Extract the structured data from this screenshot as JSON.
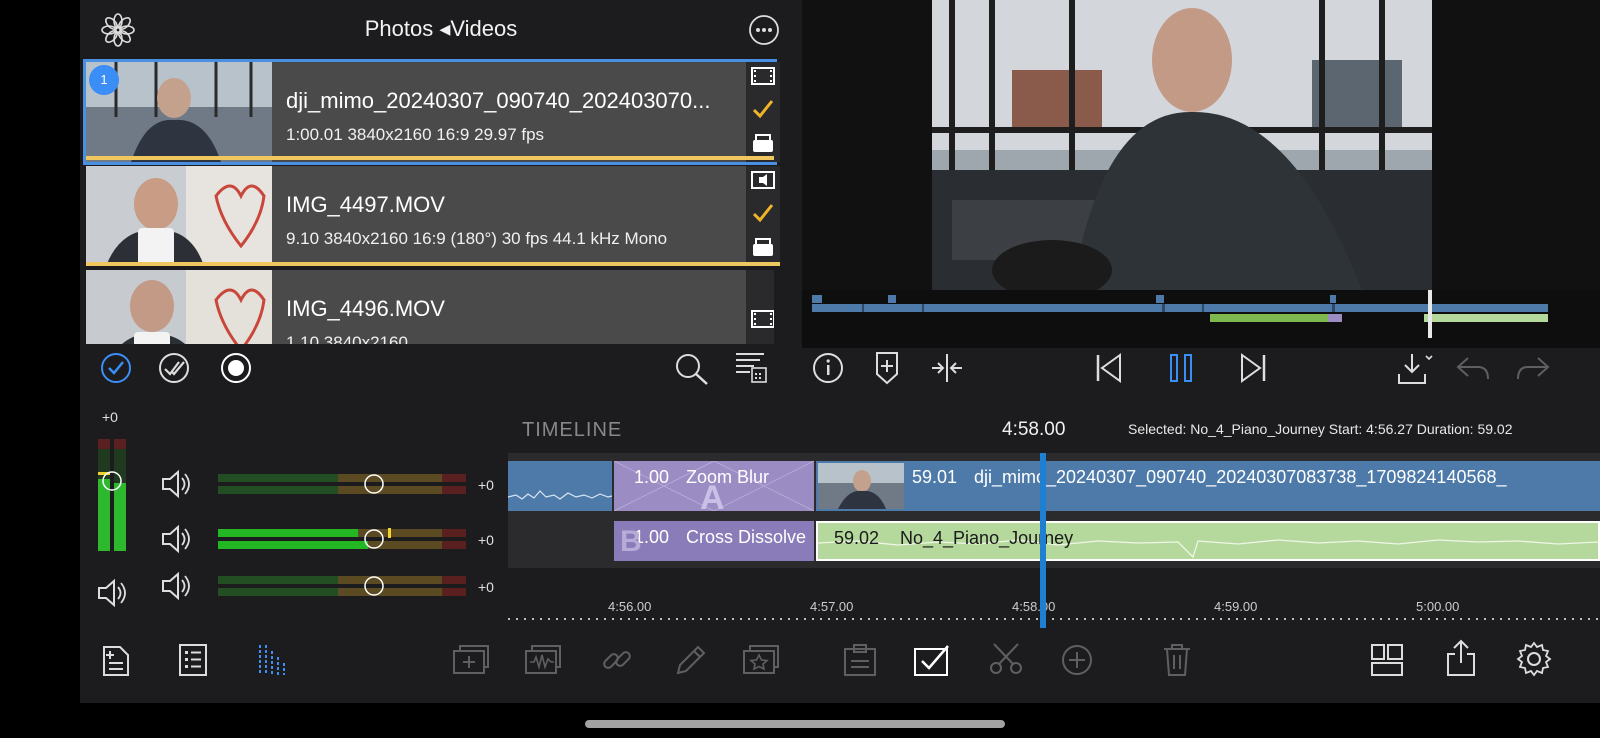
{
  "browser": {
    "title": "Photos ◂Videos",
    "items": [
      {
        "name": "dji_mimo_20240307_090740_202403070...",
        "meta": "1:00.01   3840x2160   16:9   29.97 fps",
        "badge": "1"
      },
      {
        "name": "IMG_4497.MOV",
        "meta": "9.10   3840x2160   16:9   (180°)   30 fps   44.1 kHz   Mono"
      },
      {
        "name": "IMG_4496.MOV",
        "meta": "1.10   3840x2160"
      }
    ]
  },
  "meters": {
    "master_label": "+0",
    "rows": [
      {
        "value": "+0"
      },
      {
        "value": "+0"
      },
      {
        "value": "+0"
      }
    ]
  },
  "timeline": {
    "label": "TIMELINE",
    "current_time": "4:58.00",
    "selected_info": "Selected: No_4_Piano_Journey Start: 4:56.27 Duration: 59.02",
    "clips": {
      "transition_a_duration": "1.00",
      "transition_a_name": "Zoom Blur",
      "transition_a_letter": "A",
      "video_duration": "59.01",
      "video_name": "dji_mimo_20240307_090740_20240307083738_1709824140568_",
      "transition_b_duration": "1.00",
      "transition_b_name": "Cross Dissolve",
      "transition_b_letter": "B",
      "audio_duration": "59.02",
      "audio_name": "No_4_Piano_Journey"
    },
    "ruler": [
      "4:56.00",
      "4:57.00",
      "4:58.00",
      "4:59.00",
      "5:00.00"
    ]
  },
  "colors": {
    "accent": "#4a90e2",
    "selection_bar": "#f0c75e",
    "video_clip": "#4d7aa8",
    "transition": "#9b8cc4",
    "audio_clip": "#b5d99c",
    "playhead": "#1f7fd0"
  }
}
